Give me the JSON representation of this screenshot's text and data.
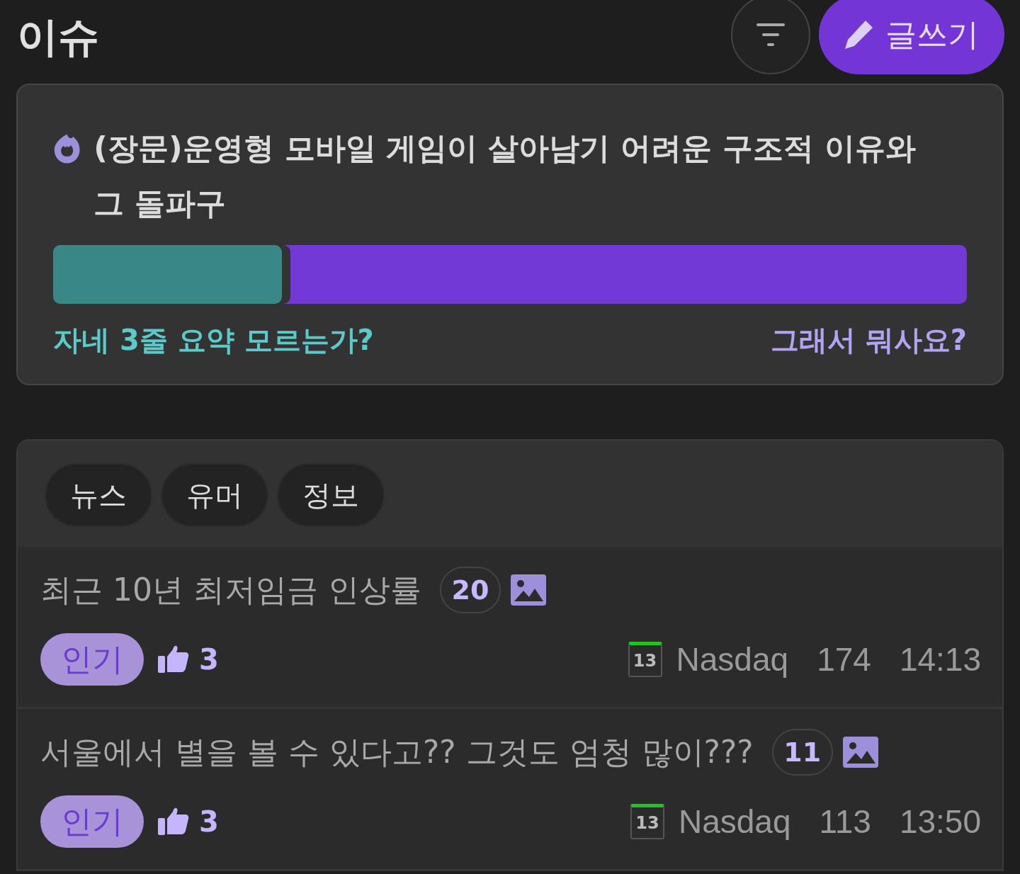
{
  "header": {
    "title": "이슈",
    "write_button": "글쓰기"
  },
  "featured": {
    "title": "(장문)운영형 모바일 게임이 살아남기 어려운 구조적 이유와 그 돌파구",
    "poll": {
      "level": 0.25,
      "left_label": "자네 3줄 요약 모르는가?",
      "right_label": "그래서 뭐사요?"
    }
  },
  "tabs": [
    "뉴스",
    "유머",
    "정보"
  ],
  "posts": [
    {
      "title": "최근 10년 최저임금 인상률",
      "comments": "20",
      "has_image": true,
      "badge": "인기",
      "likes": "3",
      "level_badge": "13",
      "author": "Nasdaq",
      "views": "174",
      "time": "14:13"
    },
    {
      "title": "서울에서 별을 볼 수 있다고?? 그것도 엄청 많이???",
      "comments": "11",
      "has_image": true,
      "badge": "인기",
      "likes": "3",
      "level_badge": "13",
      "author": "Nasdaq",
      "views": "113",
      "time": "13:50"
    }
  ]
}
